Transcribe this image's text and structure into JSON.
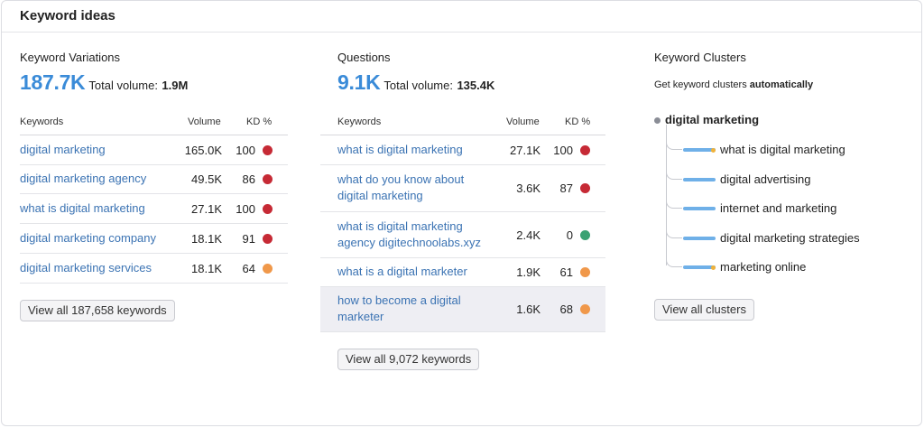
{
  "header": {
    "title": "Keyword ideas"
  },
  "colors": {
    "link": "#3b73b3",
    "accent": "#3a8bd8",
    "kd_red": "#c62a35",
    "kd_orange": "#f0984a",
    "kd_green": "#3aa273"
  },
  "variations": {
    "title": "Keyword Variations",
    "count": "187.7K",
    "total_label": "Total volume:",
    "total_value": "1.9M",
    "headers": {
      "keyword": "Keywords",
      "volume": "Volume",
      "kd": "KD %"
    },
    "rows": [
      {
        "keyword": "digital marketing",
        "volume": "165.0K",
        "kd": "100",
        "level": "red"
      },
      {
        "keyword": "digital marketing agency",
        "volume": "49.5K",
        "kd": "86",
        "level": "red"
      },
      {
        "keyword": "what is digital marketing",
        "volume": "27.1K",
        "kd": "100",
        "level": "red"
      },
      {
        "keyword": "digital marketing company",
        "volume": "18.1K",
        "kd": "91",
        "level": "red"
      },
      {
        "keyword": "digital marketing services",
        "volume": "18.1K",
        "kd": "64",
        "level": "orange"
      }
    ],
    "button": "View all 187,658 keywords"
  },
  "questions": {
    "title": "Questions",
    "count": "9.1K",
    "total_label": "Total volume:",
    "total_value": "135.4K",
    "headers": {
      "keyword": "Keywords",
      "volume": "Volume",
      "kd": "KD %"
    },
    "rows": [
      {
        "keyword": "what is digital marketing",
        "volume": "27.1K",
        "kd": "100",
        "level": "red"
      },
      {
        "keyword": "what do you know about digital marketing",
        "volume": "3.6K",
        "kd": "87",
        "level": "red"
      },
      {
        "keyword": "what is digital marketing agency digitechnoolabs.xyz",
        "volume": "2.4K",
        "kd": "0",
        "level": "green"
      },
      {
        "keyword": "what is a digital marketer",
        "volume": "1.9K",
        "kd": "61",
        "level": "orange"
      },
      {
        "keyword": "how to become a digital marketer",
        "volume": "1.6K",
        "kd": "68",
        "level": "orange"
      }
    ],
    "button": "View all 9,072 keywords"
  },
  "clusters": {
    "title": "Keyword Clusters",
    "subtitle_prefix": "Get keyword clusters",
    "subtitle_bold": "automatically",
    "root": "digital marketing",
    "items": [
      {
        "label": "what is digital marketing",
        "tip": true
      },
      {
        "label": "digital advertising",
        "tip": false
      },
      {
        "label": "internet and marketing",
        "tip": false
      },
      {
        "label": "digital marketing strategies",
        "tip": false
      },
      {
        "label": "marketing online",
        "tip": true
      }
    ],
    "button": "View all clusters"
  }
}
